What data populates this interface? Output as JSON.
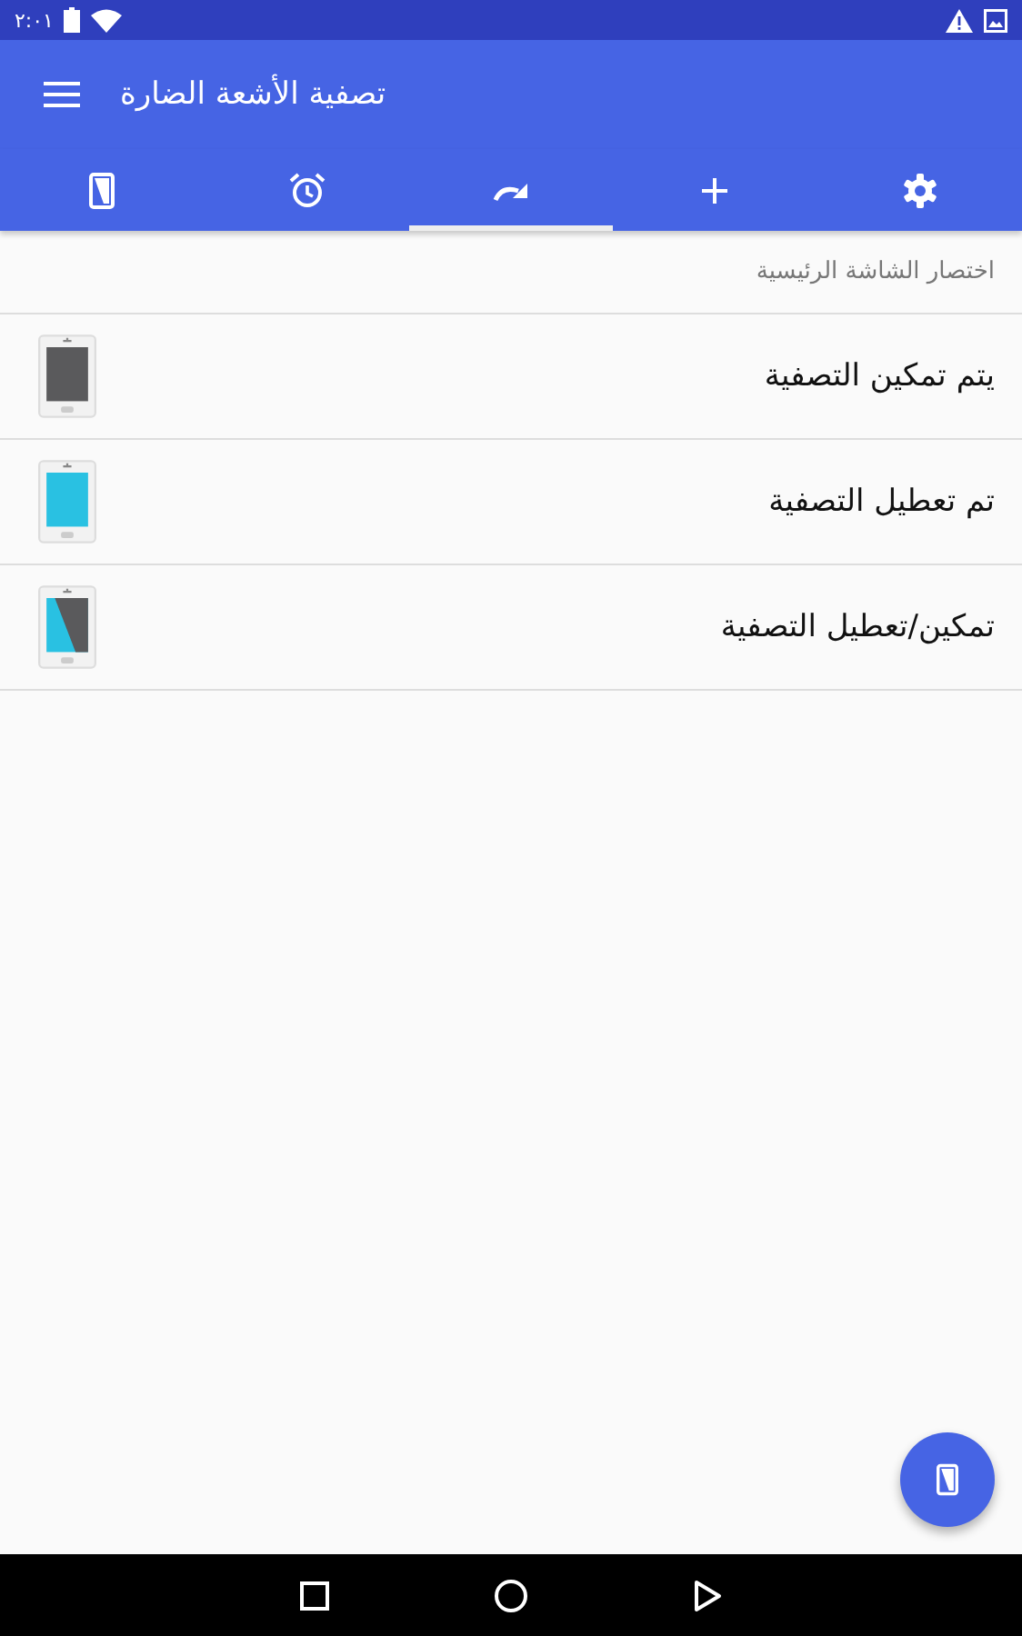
{
  "status_bar": {
    "time": "٢:٠١"
  },
  "app_bar": {
    "title": "تصفية الأشعة الضارة"
  },
  "tabs": [
    {
      "kind": "phone",
      "selected": false
    },
    {
      "kind": "alarm",
      "selected": false
    },
    {
      "kind": "redo",
      "selected": true
    },
    {
      "kind": "plus",
      "selected": false
    },
    {
      "kind": "gear",
      "selected": false
    }
  ],
  "section": {
    "heading": "اختصار الشاشة الرئيسية"
  },
  "shortcuts": [
    {
      "label": "يتم تمكين التصفية",
      "kind": "enabled"
    },
    {
      "label": "تم تعطيل التصفية",
      "kind": "disabled"
    },
    {
      "label": "تمكين/تعطيل التصفية",
      "kind": "toggle"
    }
  ]
}
